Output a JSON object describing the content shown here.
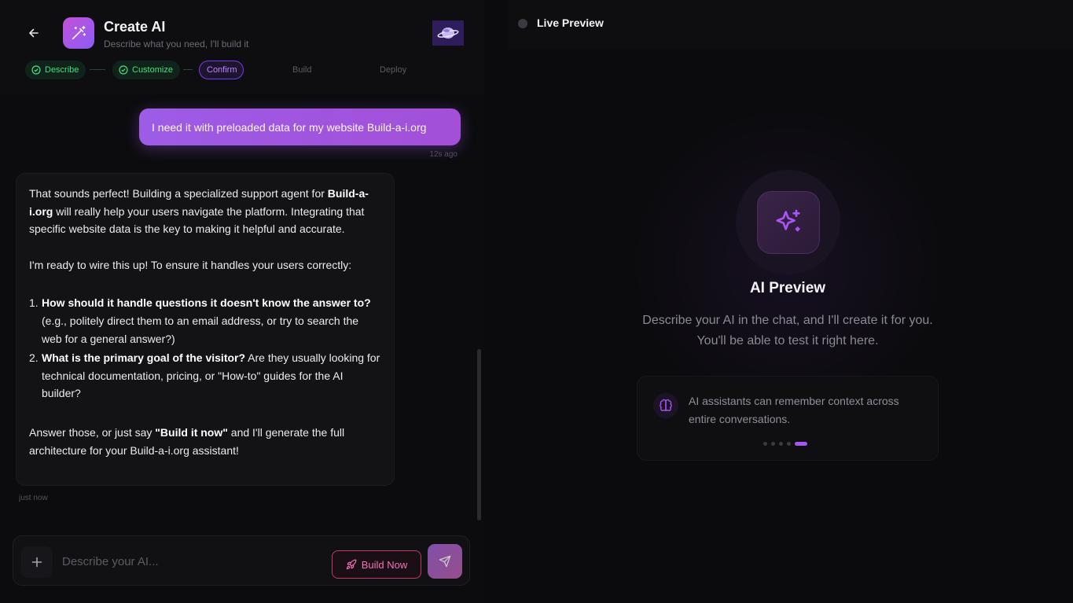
{
  "header": {
    "title": "Create AI",
    "subtitle": "Describe what you need, I'll build it"
  },
  "steps": [
    {
      "label": "Describe",
      "state": "done"
    },
    {
      "label": "Customize",
      "state": "done"
    },
    {
      "label": "Confirm",
      "state": "active"
    },
    {
      "label": "Build",
      "state": "todo"
    },
    {
      "label": "Deploy",
      "state": "todo"
    }
  ],
  "chat": {
    "user_message": "I need it with preloaded data for my website Build-a-i.org",
    "user_time": "12s ago",
    "ai_message": {
      "p1_a": "That sounds perfect! Building a specialized support agent for ",
      "p1_bold": "Build-a-i.org",
      "p1_b": " will really help your users navigate the platform. Integrating that specific website data is the key to making it helpful and accurate.",
      "p2": "I'm ready to wire this up! To ensure it handles your users correctly:",
      "items": [
        {
          "num": "1.",
          "bold": "How should it handle questions it doesn't know the answer to?",
          "rest": " (e.g., politely direct them to an email address, or try to search the web for a general answer?)"
        },
        {
          "num": "2.",
          "bold": "What is the primary goal of the visitor?",
          "rest": " Are they usually looking for technical documentation, pricing, or \"How-to\" guides for the AI builder?"
        }
      ],
      "p3_a": "Answer those, or just say ",
      "p3_bold": "\"Build it now\"",
      "p3_b": " and I'll generate the full architecture for your Build-a-i.org assistant!"
    },
    "ai_time": "just now"
  },
  "composer": {
    "placeholder": "Describe your AI...",
    "build_now_label": "Build Now"
  },
  "preview": {
    "header_label": "Live Preview",
    "title": "AI Preview",
    "description": "Describe your AI in the chat, and I'll create it for you. You'll be able to test it right here.",
    "tip": "AI assistants can remember context across entire conversations.",
    "tip_total": 5,
    "tip_active_index": 4
  },
  "colors": {
    "accent": "#a855f7",
    "success": "#4ade80",
    "build_now": "#f472b6"
  }
}
